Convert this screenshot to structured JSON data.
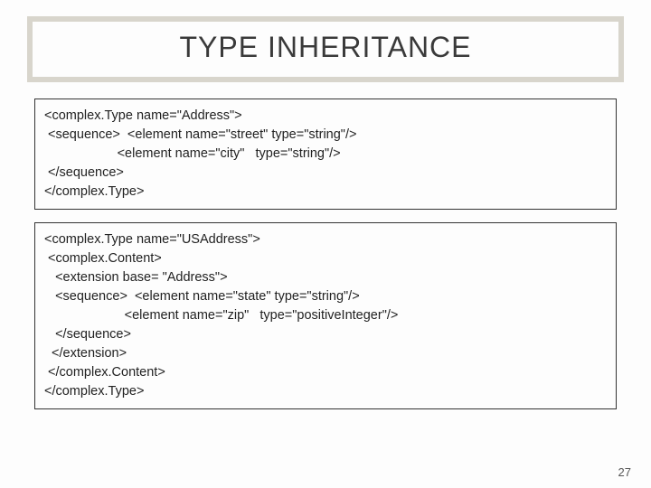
{
  "title": "TYPE INHERITANCE",
  "code_block_1": "<complex.Type name=\"Address\">\n <sequence>  <element name=\"street\" type=\"string\"/>\n                    <element name=\"city\"   type=\"string\"/>\n </sequence>\n</complex.Type>",
  "code_block_2": "<complex.Type name=\"USAddress\">\n <complex.Content>\n   <extension base= \"Address\">\n   <sequence>  <element name=\"state\" type=\"string\"/>\n                      <element name=\"zip\"   type=\"positiveInteger\"/>\n   </sequence>\n  </extension>\n </complex.Content>\n</complex.Type>",
  "page_number": "27"
}
